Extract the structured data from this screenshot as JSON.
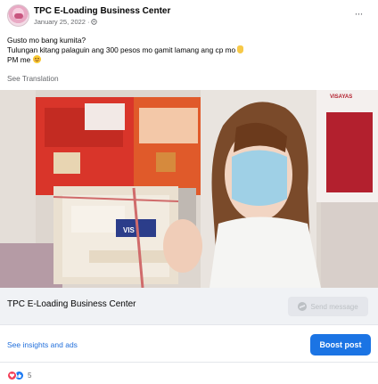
{
  "post": {
    "page_name": "TPC E-Loading Business Center",
    "date": "January 25, 2022",
    "separator": "·",
    "more_label": "···",
    "message_lines": [
      "Gusto mo bang kumita?",
      "Tulungan kitang palaguin ang 300 pesos mo gamit lamang ang cp mo",
      "PM me"
    ],
    "see_translation": "See Translation"
  },
  "link_bar": {
    "title": "TPC E-Loading Business Center",
    "send_message": "Send message"
  },
  "footer": {
    "insights": "See insights and ads",
    "boost": "Boost post",
    "reaction_count": "5"
  },
  "photo": {
    "box_label": "VIS",
    "poster_header_right": "VISAYAS"
  },
  "colors": {
    "primary_blue": "#1b74e4",
    "link_blue": "#216fdb",
    "muted_gray": "#65676b",
    "bar_gray": "#f0f2f5"
  }
}
